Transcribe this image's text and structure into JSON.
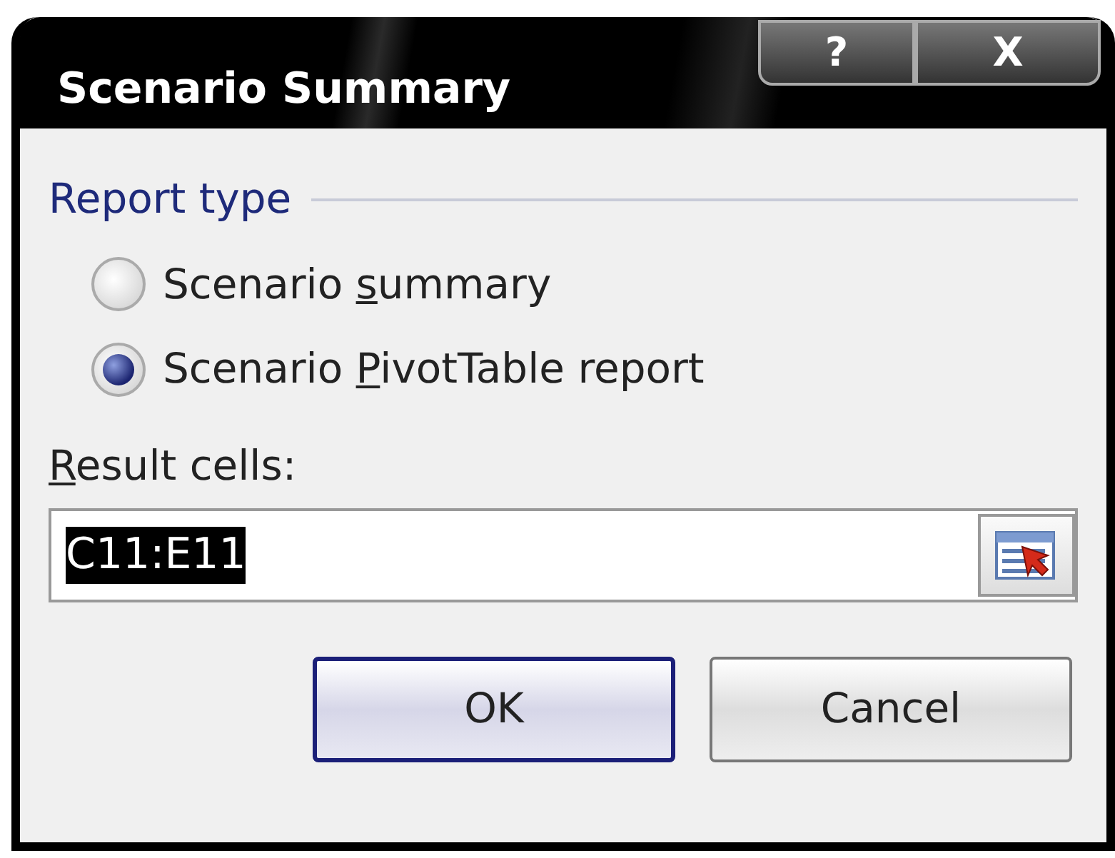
{
  "window": {
    "title": "Scenario Summary",
    "title_buttons": [
      "?",
      "X"
    ]
  },
  "report_type": {
    "label": "Report type",
    "options": [
      {
        "before": "Scenario ",
        "access_key": "s",
        "after": "ummary",
        "selected": false
      },
      {
        "before": "Scenario ",
        "access_key": "P",
        "after": "ivotTable report",
        "selected": true
      }
    ]
  },
  "result_cells": {
    "label": {
      "access_key": "R",
      "after": "esult cells:"
    },
    "value": "C11:E11",
    "value_selected": true
  },
  "buttons": [
    {
      "label": "OK",
      "default": true
    },
    {
      "label": "Cancel",
      "default": false
    }
  ]
}
